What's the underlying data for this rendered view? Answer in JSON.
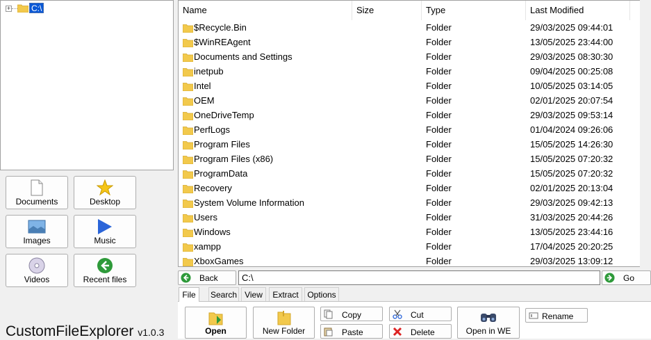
{
  "tree": {
    "root_label": "C:\\",
    "expander": "+"
  },
  "quick_access": [
    {
      "label": "Documents",
      "icon": "document-icon"
    },
    {
      "label": "Desktop",
      "icon": "star-icon"
    },
    {
      "label": "Images",
      "icon": "image-icon"
    },
    {
      "label": "Music",
      "icon": "play-icon"
    },
    {
      "label": "Videos",
      "icon": "disc-icon"
    },
    {
      "label": "Recent files",
      "icon": "back-arrow-icon"
    }
  ],
  "app": {
    "title": "CustomFileExplorer",
    "version": "v1.0.3"
  },
  "columns": {
    "name": "Name",
    "size": "Size",
    "type": "Type",
    "modified": "Last Modified"
  },
  "files": [
    {
      "name": "$Recycle.Bin",
      "type": "Folder",
      "modified": "29/03/2025 09:44:01"
    },
    {
      "name": "$WinREAgent",
      "type": "Folder",
      "modified": "13/05/2025 23:44:00"
    },
    {
      "name": "Documents and Settings",
      "type": "Folder",
      "modified": "29/03/2025 08:30:30"
    },
    {
      "name": "inetpub",
      "type": "Folder",
      "modified": "09/04/2025 00:25:08"
    },
    {
      "name": "Intel",
      "type": "Folder",
      "modified": "10/05/2025 03:14:05"
    },
    {
      "name": "OEM",
      "type": "Folder",
      "modified": "02/01/2025 20:07:54"
    },
    {
      "name": "OneDriveTemp",
      "type": "Folder",
      "modified": "29/03/2025 09:53:14"
    },
    {
      "name": "PerfLogs",
      "type": "Folder",
      "modified": "01/04/2024 09:26:06"
    },
    {
      "name": "Program Files",
      "type": "Folder",
      "modified": "15/05/2025 14:26:30"
    },
    {
      "name": "Program Files (x86)",
      "type": "Folder",
      "modified": "15/05/2025 07:20:32"
    },
    {
      "name": "ProgramData",
      "type": "Folder",
      "modified": "15/05/2025 07:20:32"
    },
    {
      "name": "Recovery",
      "type": "Folder",
      "modified": "02/01/2025 20:13:04"
    },
    {
      "name": "System Volume Information",
      "type": "Folder",
      "modified": "29/03/2025 09:42:13"
    },
    {
      "name": "Users",
      "type": "Folder",
      "modified": "31/03/2025 20:44:26"
    },
    {
      "name": "Windows",
      "type": "Folder",
      "modified": "13/05/2025 23:44:16"
    },
    {
      "name": "xampp",
      "type": "Folder",
      "modified": "17/04/2025 20:20:25"
    },
    {
      "name": "XboxGames",
      "type": "Folder",
      "modified": "29/03/2025 13:09:12"
    }
  ],
  "address": {
    "back_label": "Back",
    "path": "C:\\",
    "go_label": "Go"
  },
  "tabs": [
    {
      "label": "File",
      "active": true
    },
    {
      "label": "Search"
    },
    {
      "label": "View"
    },
    {
      "label": "Extract"
    },
    {
      "label": "Options"
    }
  ],
  "ribbon": {
    "open": "Open",
    "new_folder": "New Folder",
    "copy": "Copy",
    "paste": "Paste",
    "cut": "Cut",
    "delete": "Delete",
    "open_in_we": "Open in WE",
    "rename": "Rename"
  },
  "colors": {
    "folder": "#f2c94c",
    "selection": "#0a58d6",
    "green": "#2e9a3a"
  }
}
